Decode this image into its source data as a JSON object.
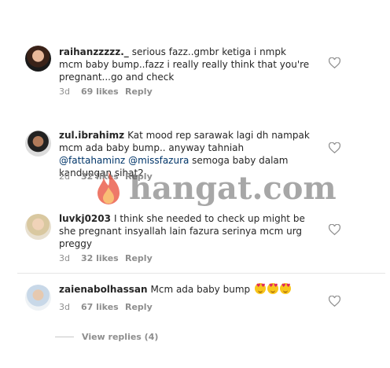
{
  "comments": [
    {
      "username": "raihanzzzzz._",
      "text": "serious fazz..gmbr ketiga i nmpk mcm baby bump..fazz i really really think that you're pregnant...go and check",
      "time": "3d",
      "likes": "69 likes",
      "reply": "Reply"
    },
    {
      "username": "zul.ibrahimz",
      "text_before": "Kat mood rep sarawak lagi dh nampak mcm ada baby bump.. anyway tahniah ",
      "mention1": "@fattahaminz",
      "mention2": "@missfazura",
      "text_after": " semoga baby dalam kandungan sihat2",
      "time": "2d",
      "likes": "32 likes",
      "reply": "Reply"
    },
    {
      "username": "luvkj0203",
      "text": "I think she needed to check up might be she pregnant insyallah lain fazura serinya mcm urg preggy",
      "time": "3d",
      "likes": "32 likes",
      "reply": "Reply"
    },
    {
      "username": "zaienabolhassan",
      "text": "Mcm ada baby bump",
      "emojis": [
        "heart-eyes",
        "heart-eyes",
        "heart-eyes"
      ],
      "time": "3d",
      "likes": "67 likes",
      "reply": "Reply"
    }
  ],
  "view_replies": "View replies (4)",
  "watermark": "hangat.com",
  "colors": {
    "text": "#262626",
    "muted": "#8e8e8e",
    "mention": "#003569",
    "watermark_flame": "#e8402a"
  },
  "icons": [
    "like-heart-icon",
    "flame-icon",
    "heart-eyes-emoji"
  ]
}
